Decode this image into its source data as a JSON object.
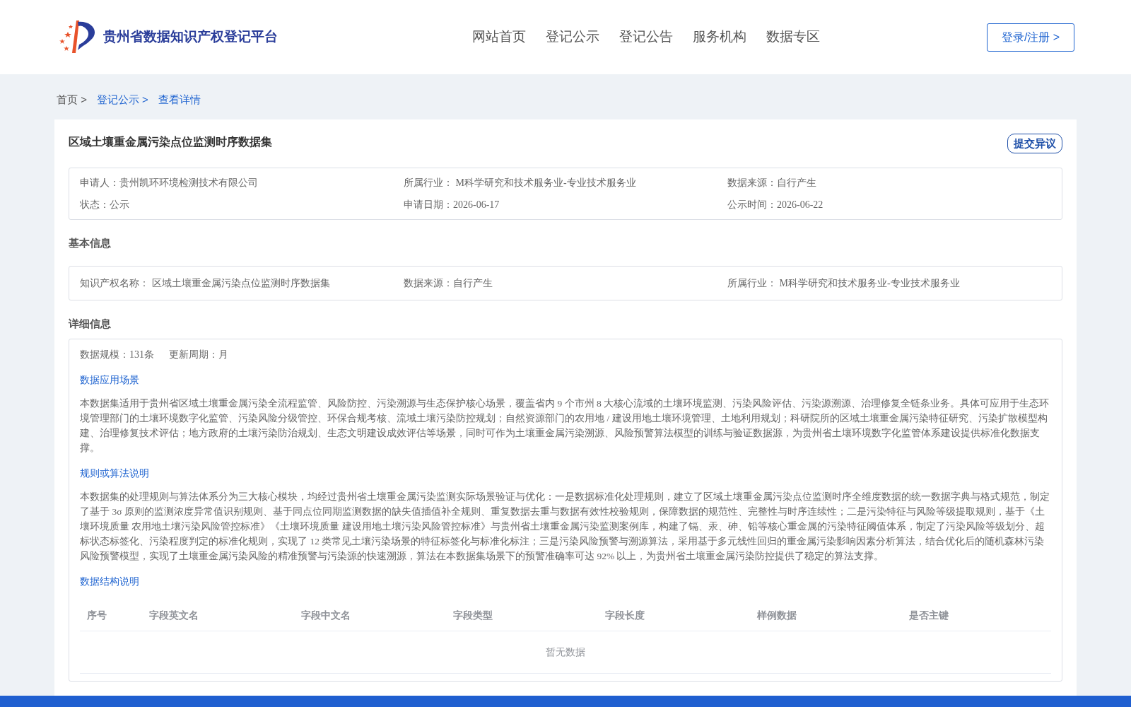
{
  "header": {
    "site_title": "贵州省数据知识产权登记平台",
    "nav": [
      {
        "label": "网站首页",
        "selected": false
      },
      {
        "label": "登记公示",
        "selected": false
      },
      {
        "label": "登记公告",
        "selected": false
      },
      {
        "label": "服务机构",
        "selected": false
      },
      {
        "label": "数据专区",
        "selected": false
      }
    ],
    "login_button": "登录/注册 >"
  },
  "breadcrumb": [
    {
      "label": "首页 >",
      "kind": "plain"
    },
    {
      "label": "登记公示 >",
      "kind": "link"
    },
    {
      "label": "查看详情",
      "kind": "link"
    }
  ],
  "detail": {
    "title": "区域土壤重金属污染点位监测时序数据集",
    "objection_button": "提交异议",
    "summary": [
      {
        "label": "申请人：",
        "value": "贵州凯环环境检测技术有限公司"
      },
      {
        "label": "所属行业：",
        "value": " M科学研究和技术服务业-专业技术服务业"
      },
      {
        "label": "数据来源：",
        "value": "自行产生"
      },
      {
        "label": "状态：",
        "value": "公示"
      },
      {
        "label": "申请日期：",
        "value": "2026-06-17"
      },
      {
        "label": "公示时间：",
        "value": "2026-06-22"
      }
    ],
    "basic_info": {
      "heading": "基本信息",
      "fields": [
        {
          "label": "知识产权名称：",
          "value": " 区域土壤重金属污染点位监测时序数据集"
        },
        {
          "label": "数据来源：",
          "value": "自行产生"
        },
        {
          "label": "所属行业：",
          "value": " M科学研究和技术服务业-专业技术服务业"
        }
      ]
    },
    "detail_info": {
      "heading": "详细信息",
      "stats": [
        {
          "label": "数据规模：",
          "value": "131条"
        },
        {
          "label": "更新周期：",
          "value": "月"
        }
      ],
      "sections": [
        {
          "heading": "数据应用场景",
          "text": "本数据集适用于贵州省区域土壤重金属污染全流程监管、风险防控、污染溯源与生态保护核心场景，覆盖省内 9 个市州 8 大核心流域的土壤环境监测、污染风险评估、污染源溯源、治理修复全链条业务。具体可应用于生态环境管理部门的土壤环境数字化监管、污染风险分级管控、环保合规考核、流域土壤污染防控规划；自然资源部门的农用地 / 建设用地土壤环境管理、土地利用规划；科研院所的区域土壤重金属污染特征研究、污染扩散模型构建、治理修复技术评估；地方政府的土壤污染防治规划、生态文明建设成效评估等场景，同时可作为土壤重金属污染溯源、风险预警算法模型的训练与验证数据源，为贵州省土壤环境数字化监管体系建设提供标准化数据支撑。"
        },
        {
          "heading": "规则或算法说明",
          "text": "本数据集的处理规则与算法体系分为三大核心模块，均经过贵州省土壤重金属污染监测实际场景验证与优化：一是数据标准化处理规则，建立了区域土壤重金属污染点位监测时序全维度数据的统一数据字典与格式规范，制定了基于 3σ 原则的监测浓度异常值识别规则、基于同点位同期监测数据的缺失值插值补全规则、重复数据去重与数据有效性校验规则，保障数据的规范性、完整性与时序连续性；二是污染特征与风险等级提取规则，基于《土壤环境质量 农用地土壤污染风险管控标准》《土壤环境质量 建设用地土壤污染风险管控标准》与贵州省土壤重金属污染监测案例库，构建了镉、汞、砷、铅等核心重金属的污染特征阈值体系，制定了污染风险等级划分、超标状态标签化、污染程度判定的标准化规则，实现了 12 类常见土壤污染场景的特征标签化与标准化标注；三是污染风险预警与溯源算法，采用基于多元线性回归的重金属污染影响因素分析算法，结合优化后的随机森林污染风险预警模型，实现了土壤重金属污染风险的精准预警与污染源的快速溯源，算法在本数据集场景下的预警准确率可达 92% 以上，为贵州省土壤重金属污染防控提供了稳定的算法支撑。"
        }
      ],
      "structure": {
        "heading": "数据结构说明",
        "columns": [
          "序号",
          "字段英文名",
          "字段中文名",
          "字段类型",
          "字段长度",
          "样例数据",
          "是否主键"
        ],
        "empty_text": "暂无数据"
      }
    }
  }
}
